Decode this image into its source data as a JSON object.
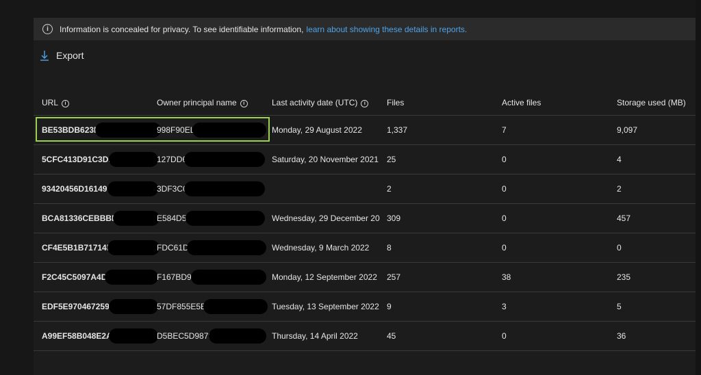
{
  "notice": {
    "text": "Information is concealed for privacy. To see identifiable information,",
    "link": "learn about showing these details in reports."
  },
  "toolbar": {
    "export_label": "Export"
  },
  "table": {
    "headers": [
      "URL",
      "Owner principal name",
      "Last activity date (UTC)",
      "Files",
      "Active files",
      "Storage used (MB)"
    ],
    "rows": [
      {
        "url": "BE53BDB623F",
        "owner": "998F90EL",
        "date": "Monday, 29 August 2022",
        "files": "1,337",
        "active": "7",
        "storage": "9,097"
      },
      {
        "url": "5CFC413D91C3D.",
        "owner": "127DD6",
        "date": "Saturday, 20 November 2021",
        "files": "25",
        "active": "0",
        "storage": "4"
      },
      {
        "url": "93420456D16149",
        "owner": "3DF3C6.",
        "date": "",
        "files": "2",
        "active": "0",
        "storage": "2"
      },
      {
        "url": "BCA81336CEBBBE2C",
        "owner": "E584D5C",
        "date": "Wednesday, 29 December 202",
        "files": "309",
        "active": "0",
        "storage": "457"
      },
      {
        "url": "CF4E5B1B71714DE",
        "owner": "FDC61D0.",
        "date": "Wednesday, 9 March 2022",
        "files": "8",
        "active": "0",
        "storage": "0"
      },
      {
        "url": "F2C45C5097A4D.",
        "owner": "F167BD9.",
        "date": "Monday, 12 September 2022",
        "files": "257",
        "active": "38",
        "storage": "235"
      },
      {
        "url": "EDF5E970467259C",
        "owner": "57DF855E5B.",
        "date": "Tuesday, 13 September 2022",
        "files": "9",
        "active": "3",
        "storage": "5"
      },
      {
        "url": "A99EF58B048E2AD",
        "owner": "D5BEC5D9879.",
        "date": "Thursday, 14 April 2022",
        "files": "45",
        "active": "0",
        "storage": "36"
      }
    ]
  },
  "colors": {
    "accent_link": "#4fa3e8",
    "focus_outline": "#9bd14f"
  }
}
